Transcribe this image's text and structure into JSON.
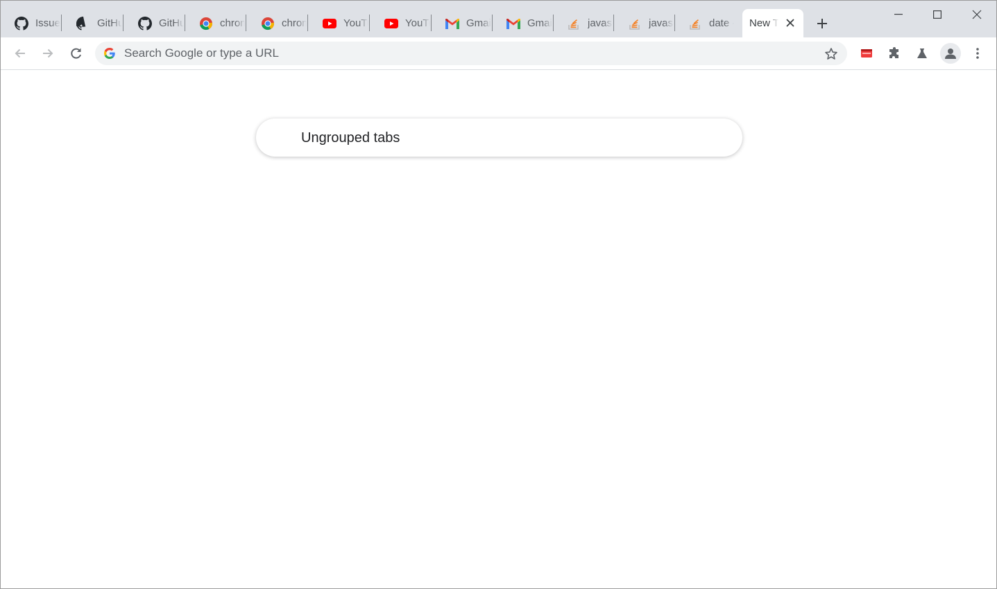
{
  "tabs": [
    {
      "title": "Issues",
      "icon": "github-icon"
    },
    {
      "title": "GitHub",
      "icon": "github-icon"
    },
    {
      "title": "GitHub",
      "icon": "github-icon"
    },
    {
      "title": "chrome",
      "icon": "chrome-icon"
    },
    {
      "title": "chrome",
      "icon": "chrome-icon"
    },
    {
      "title": "YouTube",
      "icon": "youtube-icon"
    },
    {
      "title": "YouTube",
      "icon": "youtube-icon"
    },
    {
      "title": "Gmail",
      "icon": "gmail-icon"
    },
    {
      "title": "Gmail",
      "icon": "gmail-icon"
    },
    {
      "title": "javascript",
      "icon": "stackoverflow-icon"
    },
    {
      "title": "javascript",
      "icon": "stackoverflow-icon"
    },
    {
      "title": "date -",
      "icon": "stackoverflow-icon"
    },
    {
      "title": "New Tab",
      "icon": "none",
      "active": true
    }
  ],
  "omnibox": {
    "placeholder": "Search Google or type a URL"
  },
  "main": {
    "group_label": "Ungrouped tabs"
  },
  "colors": {
    "tabstrip": "#dee1e6",
    "active_tab": "#ffffff",
    "omnibox": "#f1f3f4",
    "icon_gray": "#5f6368"
  }
}
